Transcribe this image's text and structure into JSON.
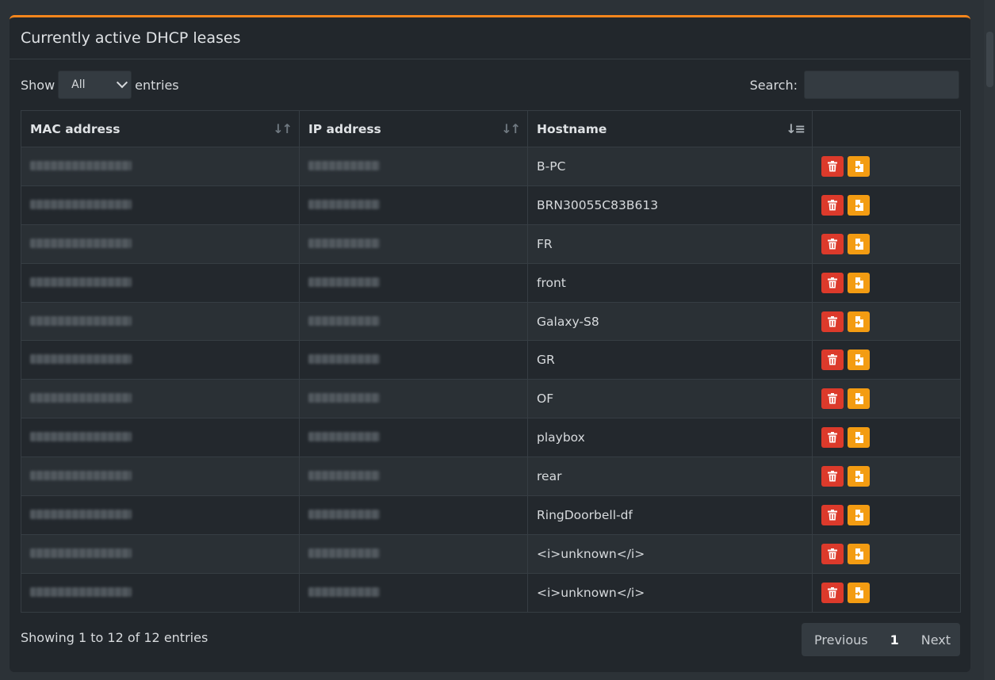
{
  "card": {
    "title": "Currently active DHCP leases"
  },
  "controls": {
    "show_label": "Show",
    "entries_label": "entries",
    "length_selected": "All",
    "search_label": "Search:",
    "search_value": ""
  },
  "table": {
    "columns": [
      "MAC address",
      "IP address",
      "Hostname",
      ""
    ],
    "rows": [
      {
        "hostname": "B-PC"
      },
      {
        "hostname": "BRN30055C83B613"
      },
      {
        "hostname": "FR"
      },
      {
        "hostname": "front"
      },
      {
        "hostname": "Galaxy-S8"
      },
      {
        "hostname": "GR"
      },
      {
        "hostname": "OF"
      },
      {
        "hostname": "playbox"
      },
      {
        "hostname": "rear"
      },
      {
        "hostname": "RingDoorbell-df"
      },
      {
        "hostname": "<i>unknown</i>"
      },
      {
        "hostname": "<i>unknown</i>"
      }
    ]
  },
  "footer": {
    "info": "Showing 1 to 12 of 12 entries",
    "prev": "Previous",
    "page": "1",
    "next": "Next"
  },
  "colors": {
    "accent": "#f7861c",
    "delete": "#dc3a2b",
    "static": "#f39c12"
  },
  "icons": {
    "sort": "sort-icon",
    "delete": "trash-icon",
    "add_static": "file-import-icon"
  }
}
